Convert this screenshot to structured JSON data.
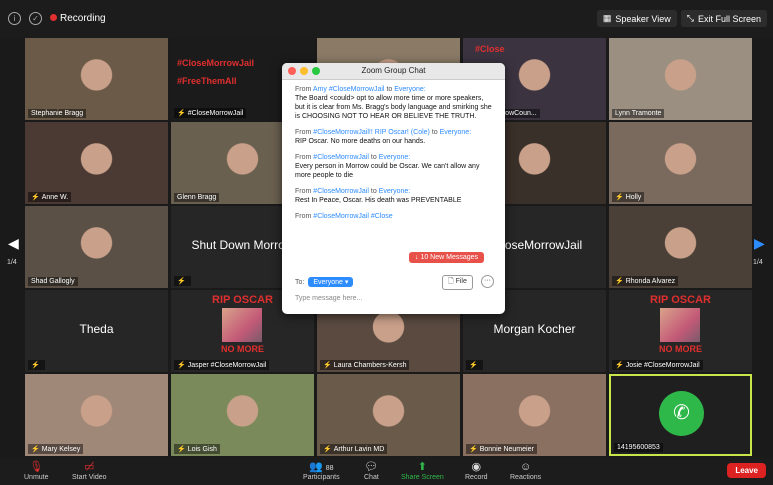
{
  "topbar": {
    "recording": "Recording",
    "speaker_view": "Speaker View",
    "exit_full_screen": "Exit Full Screen"
  },
  "colors": {
    "accent": "#2d8cff",
    "leave": "#d22222",
    "muted": "#e02f2f",
    "alert": "#e8504a",
    "call": "#2fb84a"
  },
  "tiles": [
    {
      "name": "Stephanie Bragg",
      "muted": false,
      "kind": "video"
    },
    {
      "name": "#CloseMorrowJail",
      "muted": true,
      "kind": "hashtag",
      "lines": [
        "#CloseMorrowJail",
        "#FreeThemAll"
      ]
    },
    {
      "name": "",
      "muted": false,
      "kind": "video"
    },
    {
      "name": "#CloseMorrowCoun...",
      "muted": false,
      "kind": "video",
      "overlay": "#Close"
    },
    {
      "name": "Lynn Tramonte",
      "muted": false,
      "kind": "video"
    },
    {
      "name": "Anne W.",
      "muted": true,
      "kind": "video"
    },
    {
      "name": "Glenn Bragg",
      "muted": false,
      "kind": "video"
    },
    {
      "name": "",
      "muted": false,
      "kind": "video"
    },
    {
      "name": "",
      "muted": false,
      "kind": "video"
    },
    {
      "name": "Holly",
      "muted": true,
      "kind": "video"
    },
    {
      "name": "Shad Gallogly",
      "muted": false,
      "kind": "video"
    },
    {
      "name": "",
      "muted": true,
      "kind": "text",
      "text": "Shut Down Morrow"
    },
    {
      "name": "",
      "muted": false,
      "kind": "video"
    },
    {
      "name": "",
      "muted": false,
      "kind": "text",
      "text": "#CloseMorrowJail"
    },
    {
      "name": "Rhonda Alvarez",
      "muted": true,
      "kind": "video"
    },
    {
      "name": "",
      "muted": true,
      "kind": "text",
      "text": "Theda"
    },
    {
      "name": "Jasper #CloseMorrowJail",
      "muted": true,
      "kind": "rip"
    },
    {
      "name": "Laura Chambers-Kersh",
      "muted": true,
      "kind": "video"
    },
    {
      "name": "",
      "muted": true,
      "kind": "text",
      "text": "Morgan Kocher"
    },
    {
      "name": "Josie #CloseMorrowJail",
      "muted": true,
      "kind": "rip"
    },
    {
      "name": "Mary Kelsey",
      "muted": true,
      "kind": "video"
    },
    {
      "name": "Lois Gish",
      "muted": true,
      "kind": "video"
    },
    {
      "name": "Arthur Lavin MD",
      "muted": true,
      "kind": "video"
    },
    {
      "name": "Bonnie Neumeier",
      "muted": true,
      "kind": "video"
    },
    {
      "name": "14195600853",
      "muted": false,
      "kind": "phone"
    }
  ],
  "rip": {
    "title": "RIP OSCAR",
    "footer": "NO MORE"
  },
  "pager": {
    "left": "1/4",
    "right": "1/4"
  },
  "chat": {
    "title": "Zoom Group Chat",
    "messages": [
      {
        "from": "From",
        "sender": "Amy #CloseMorrowJail",
        "to": "to",
        "recipient": "Everyone:",
        "text": "The Board <could> opt to allow more time or more speakers, but it is clear from Ms. Bragg's body language and smirking she is CHOOSING NOT TO HEAR OR BELIEVE THE TRUTH."
      },
      {
        "from": "From",
        "sender": "#CloseMorrowJail!! RIP Oscar! (Cole)",
        "to": "to",
        "recipient": "Everyone:",
        "text": "RIP Oscar. No more deaths on our hands."
      },
      {
        "from": "From",
        "sender": "#CloseMorrowJail",
        "to": "to",
        "recipient": "Everyone:",
        "text": "Every person in Morrow could be Oscar. We can't allow any more people to die"
      },
      {
        "from": "From",
        "sender": "#CloseMorrowJail",
        "to": "to",
        "recipient": "Everyone:",
        "text": "Rest In Peace, Oscar. His death was PREVENTABLE"
      },
      {
        "from": "From",
        "sender": "#CloseMorrowJail #Close",
        "to": "",
        "recipient": "",
        "text": ""
      }
    ],
    "new_messages": "↓ 10 New Messages",
    "to_label": "To:",
    "to_value": "Everyone ▾",
    "file": "File",
    "more": "···",
    "placeholder": "Type message here..."
  },
  "bottombar": {
    "unmute": "Unmute",
    "start_video": "Start Video",
    "participants": "Participants",
    "participants_count": "88",
    "chat": "Chat",
    "share_screen": "Share Screen",
    "record": "Record",
    "reactions": "Reactions",
    "leave": "Leave"
  }
}
